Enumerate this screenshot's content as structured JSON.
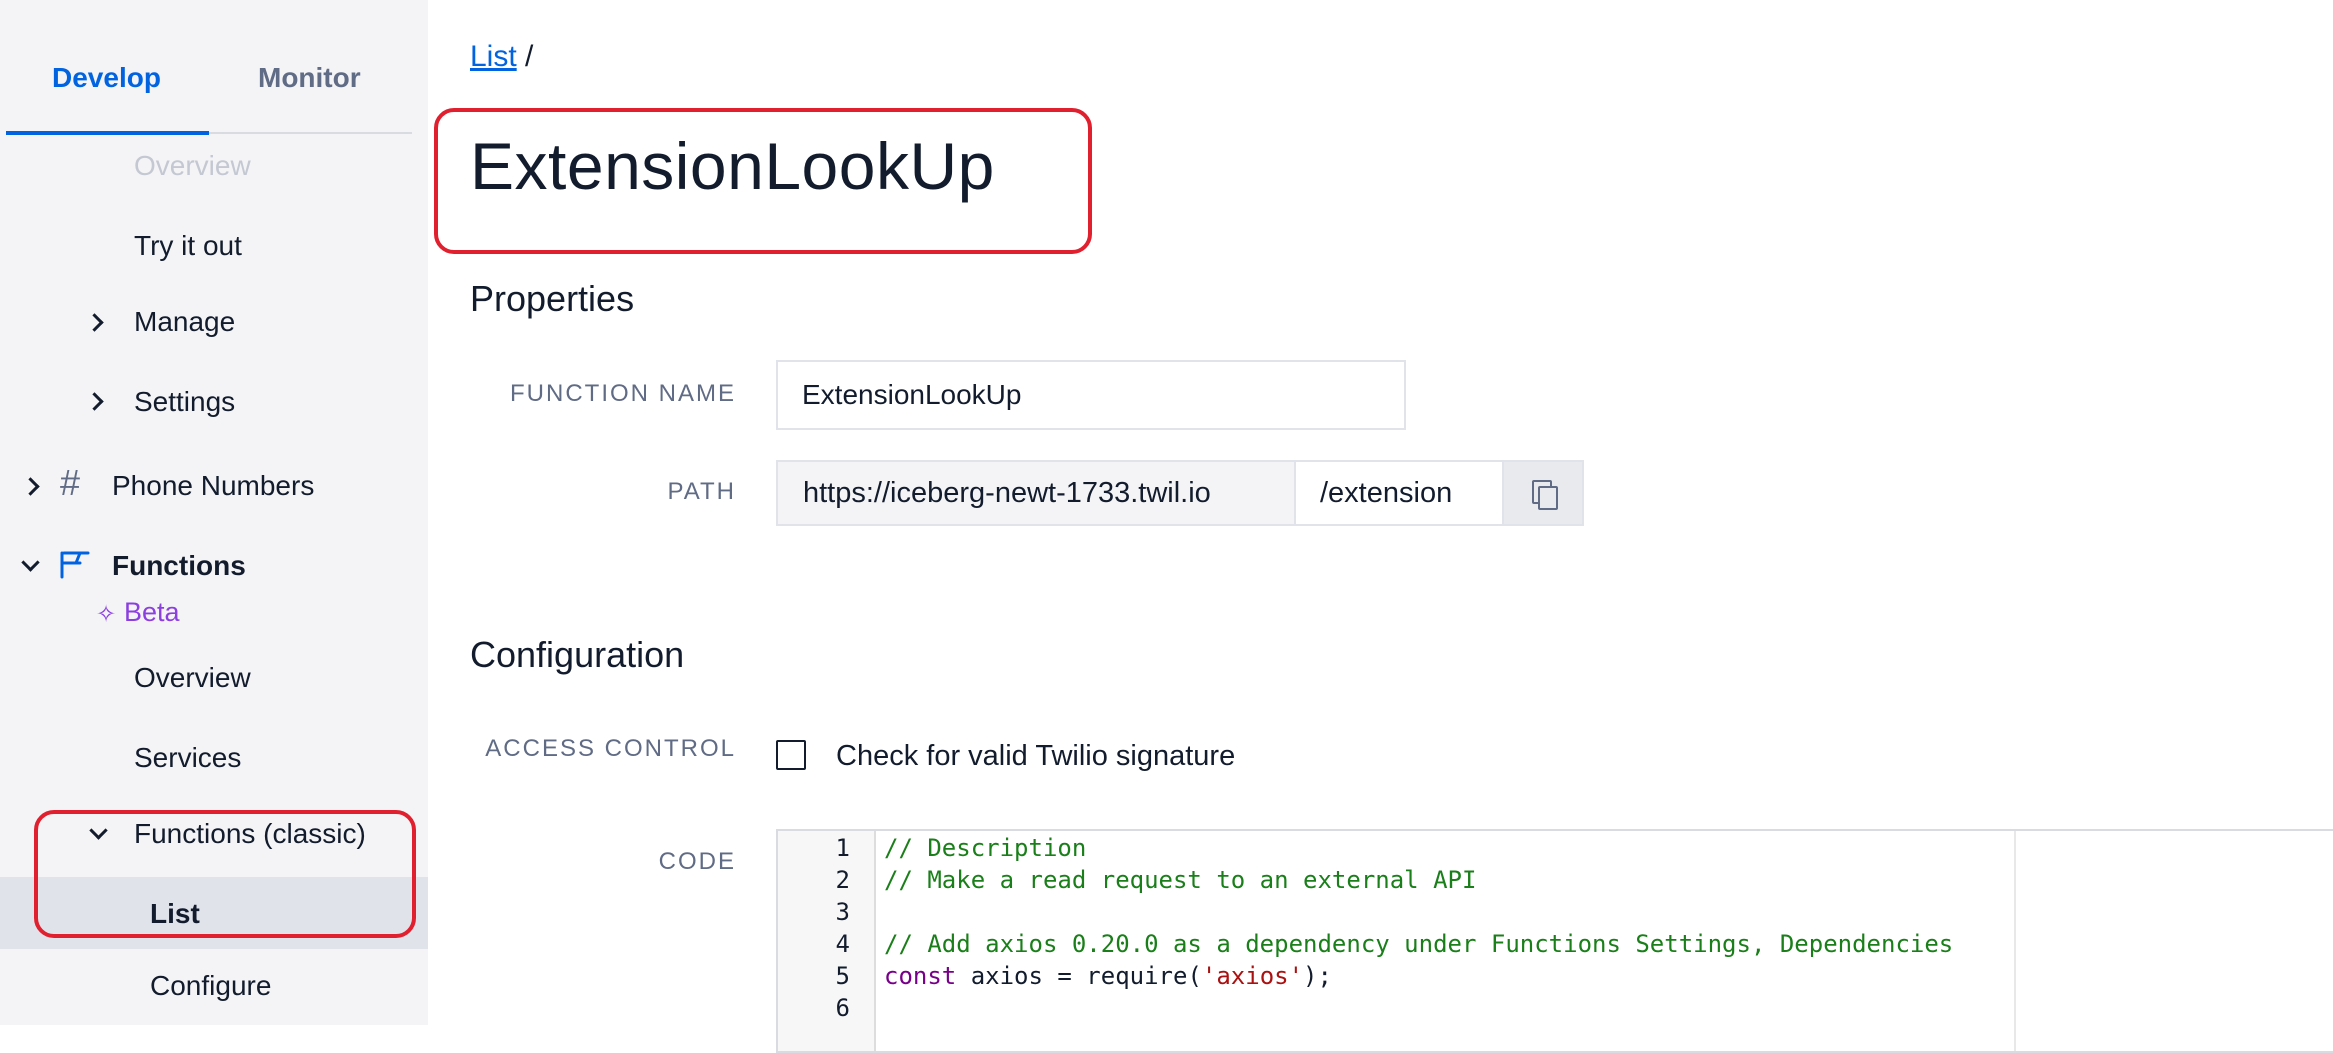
{
  "sidebar": {
    "tabs": {
      "develop": "Develop",
      "monitor": "Monitor"
    },
    "items": {
      "overview_top": "Overview",
      "try_it_out": "Try it out",
      "manage": "Manage",
      "settings": "Settings",
      "phone_numbers": "Phone Numbers",
      "functions": "Functions",
      "beta": "Beta",
      "overview": "Overview",
      "services": "Services",
      "functions_classic": "Functions (classic)",
      "list": "List",
      "configure": "Configure"
    }
  },
  "breadcrumb": {
    "link": "List",
    "separator": "/"
  },
  "page_title": "ExtensionLookUp",
  "properties": {
    "title": "Properties",
    "function_name_label": "FUNCTION NAME",
    "function_name_value": "ExtensionLookUp",
    "path_label": "PATH",
    "path_domain": "https://iceberg-newt-1733.twil.io",
    "path_value": "/extension"
  },
  "configuration": {
    "title": "Configuration",
    "access_control_label": "ACCESS CONTROL",
    "access_control_checkbox": "Check for valid Twilio signature",
    "code_label": "CODE"
  },
  "code": {
    "line_numbers": [
      "1",
      "2",
      "3",
      "4",
      "5",
      "6"
    ],
    "line1": "// Description",
    "line2": "// Make a read request to an external API",
    "line4": "// Add axios 0.20.0 as a dependency under Functions Settings, Dependencies",
    "line5_kw": "const",
    "line5_mid": " axios = require(",
    "line5_str": "'axios'",
    "line5_end": ");"
  },
  "colors": {
    "accent": "#0263e0",
    "highlight_box": "#e0202e",
    "beta": "#8c3fe0"
  }
}
